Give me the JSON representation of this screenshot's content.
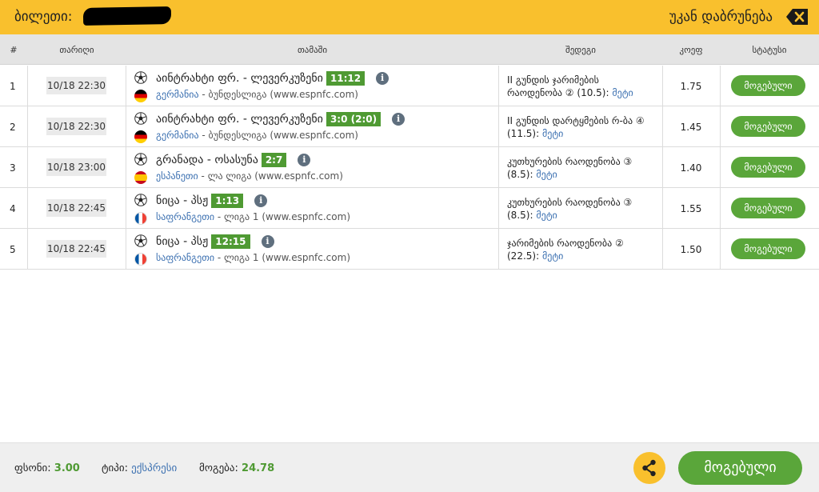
{
  "header": {
    "ticket_label": "ბილეთი:",
    "back_label": "უკან დაბრუნება"
  },
  "columns": {
    "num": "#",
    "date": "თარიღი",
    "match": "თამაში",
    "outcome": "შედეგი",
    "odds": "კოეფ",
    "status": "სტატუსი"
  },
  "rows": [
    {
      "idx": "1",
      "date": "10/18 22:30",
      "match": "აინტრახტი ფრ. - ლევერკუზენი",
      "score": "11:12",
      "country": "გერმანია",
      "league_rest": " - ბუნდესლიგა (www.espnfc.com)",
      "outcome": "II გუნდის ჯარიმების რაოდენობა ② (10.5):",
      "more": "მეტი",
      "odds": "1.75",
      "status": "მოგებული"
    },
    {
      "idx": "2",
      "date": "10/18 22:30",
      "match": "აინტრახტი ფრ. - ლევერკუზენი",
      "score": "3:0 (2:0)",
      "country": "გერმანია",
      "league_rest": " - ბუნდესლიგა (www.espnfc.com)",
      "outcome": "II გუნდის დარტყმების რ-ბა ④ (11.5):",
      "more": "მეტი",
      "odds": "1.45",
      "status": "მოგებული"
    },
    {
      "idx": "3",
      "date": "10/18 23:00",
      "match": "გრანადა - ოსასუნა",
      "score": "2:7",
      "country": "ესპანეთი",
      "league_rest": " - ლა ლიგა (www.espnfc.com)",
      "outcome": "კუთხურების რაოდენობა ③ (8.5):",
      "more": "მეტი",
      "odds": "1.40",
      "status": "მოგებული"
    },
    {
      "idx": "4",
      "date": "10/18 22:45",
      "match": "ნიცა - პსჟ",
      "score": "1:13",
      "country": "საფრანგეთი",
      "league_rest": " - ლიგა 1 (www.espnfc.com)",
      "outcome": "კუთხურების რაოდენობა ③ (8.5):",
      "more": "მეტი",
      "odds": "1.55",
      "status": "მოგებული"
    },
    {
      "idx": "5",
      "date": "10/18 22:45",
      "match": "ნიცა - პსჟ",
      "score": "12:15",
      "country": "საფრანგეთი",
      "league_rest": " - ლიგა 1 (www.espnfc.com)",
      "outcome": "ჯარიმების რაოდენობა ② (22.5):",
      "more": "მეტი",
      "odds": "1.50",
      "status": "მოგებული"
    }
  ],
  "footer": {
    "stake_label": "ფსონი:",
    "stake_value": "3.00",
    "type_label": "ტიპი:",
    "type_value": "ექსპრესი",
    "win_label": "მოგება:",
    "win_value": "24.78",
    "status_button": "მოგებული"
  },
  "colors": {
    "header_bg": "#f9c02d",
    "win_green": "#5aa63a",
    "score_green": "#4f9a33",
    "link_blue": "#3a6fb0"
  },
  "icons": {
    "back": "backspace-icon",
    "share": "share-icon",
    "info": "info-icon",
    "ball": "soccer-ball-icon"
  }
}
